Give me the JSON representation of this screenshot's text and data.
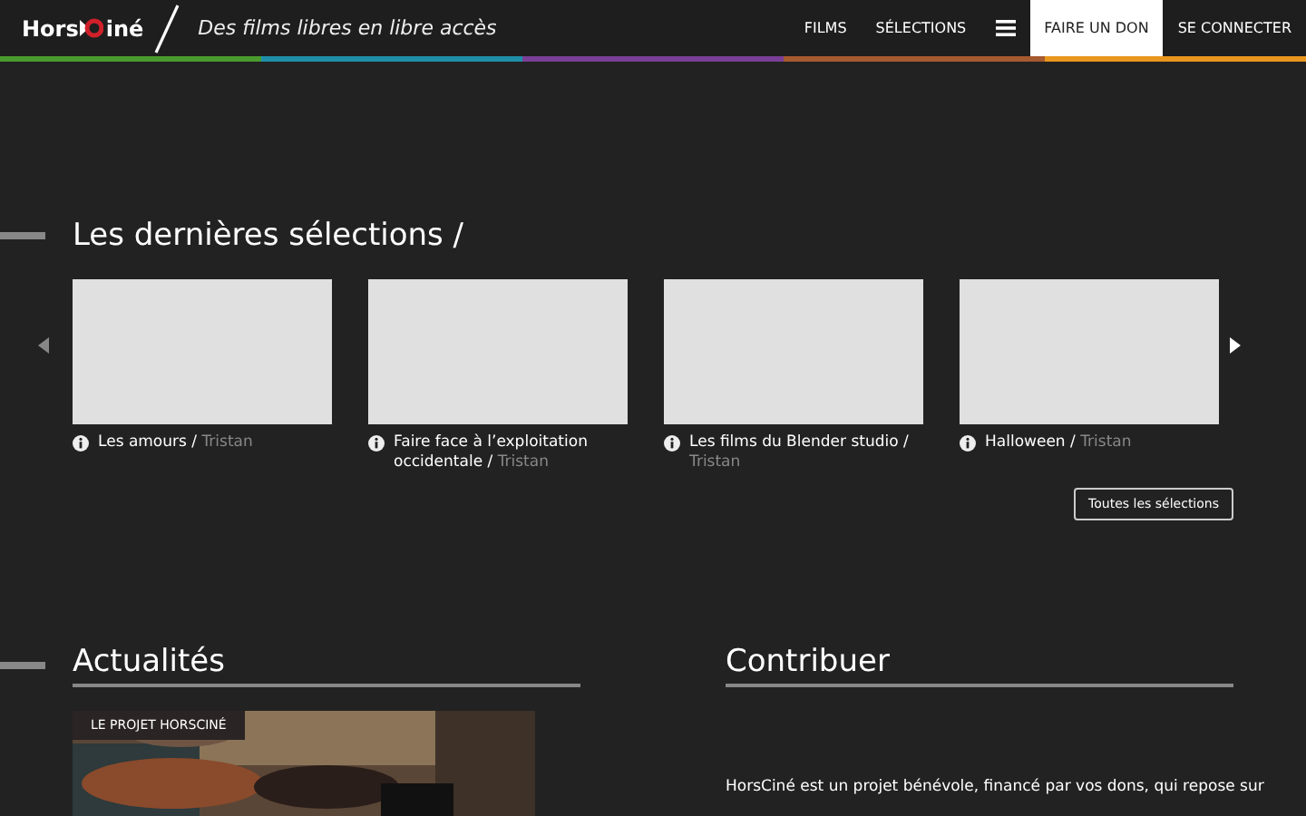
{
  "header": {
    "logo": {
      "before": "Hors",
      "after": "iné"
    },
    "tagline": "Des films libres en libre accès",
    "nav": [
      {
        "label": "FILMS",
        "kind": "link",
        "selected": false
      },
      {
        "label": "SÉLECTIONS",
        "kind": "link",
        "selected": false
      },
      {
        "kind": "menu",
        "selected": false
      },
      {
        "label": "FAIRE UN DON",
        "kind": "link",
        "selected": true
      },
      {
        "label": "SE CONNECTER",
        "kind": "link",
        "selected": false
      }
    ],
    "stripe": [
      {
        "color": "#4a9a2e"
      },
      {
        "color": "#1f8fa8"
      },
      {
        "color": "#7a3f96"
      },
      {
        "color": "#a65a30"
      },
      {
        "color": "#e8961e"
      }
    ]
  },
  "selections": {
    "title": "Les dernières sélections /",
    "items": [
      {
        "title": "Les amours /",
        "author": "Tristan"
      },
      {
        "title": "Faire face à l’exploitation occidentale /",
        "author": "Tristan"
      },
      {
        "title": "Les films du Blender studio /",
        "author": "Tristan"
      },
      {
        "title": "Halloween /",
        "author": "Tristan"
      }
    ],
    "all_button": "Toutes les sélections"
  },
  "news": {
    "title": "Actualités",
    "tag": "LE PROJET HORSCINÉ",
    "kind": "picture"
  },
  "contribute": {
    "title": "Contribuer",
    "text": "HorsCiné est un projet bénévole, financé par vos dons, qui repose sur"
  }
}
